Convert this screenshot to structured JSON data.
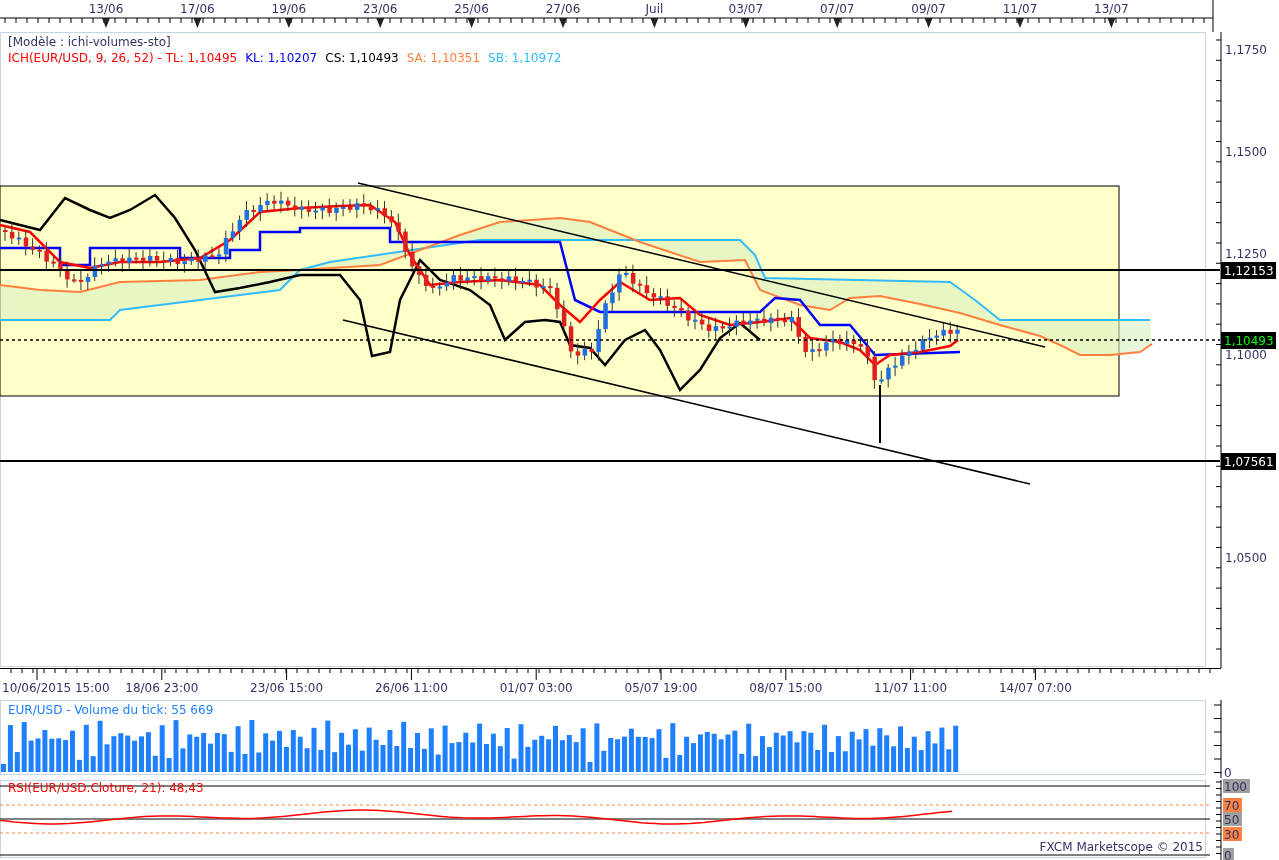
{
  "top_axis": {
    "labels": [
      "13/06",
      "17/06",
      "19/06",
      "23/06",
      "25/06",
      "27/06",
      "Juil",
      "03/07",
      "07/07",
      "09/07",
      "11/07",
      "13/07"
    ]
  },
  "legend": {
    "template": "[Modèle : ichi-volumes-sto]",
    "values": [
      {
        "text": "ICH(EUR/USD, 9, 26, 52) -  TL: 1,10495",
        "color": "#ff0000"
      },
      {
        "text": "KL: 1,10207",
        "color": "#0000ff"
      },
      {
        "text": "CS: 1,10493",
        "color": "#000000"
      },
      {
        "text": "SA: 1,10351",
        "color": "#ff7f3f"
      },
      {
        "text": "SB: 1,10972",
        "color": "#33bbff"
      }
    ]
  },
  "price_axis": {
    "labels": [
      "1,1750",
      "1,1500",
      "1,1250",
      "1,1000",
      "1,0500"
    ],
    "markers": [
      {
        "text": "1,12153",
        "color": "#ffffff"
      },
      {
        "text": "1,10493",
        "color": "#00ff00"
      },
      {
        "text": "1,07561",
        "color": "#ffffff"
      }
    ]
  },
  "time_axis": {
    "labels": [
      "10/06/2015 15:00",
      "18/06 23:00",
      "23/06 15:00",
      "26/06 11:00",
      "01/07 03:00",
      "05/07 19:00",
      "08/07 15:00",
      "11/07 11:00",
      "14/07 07:00"
    ]
  },
  "volume": {
    "title": "EUR/USD - Volume du tick: 55 669",
    "axis_label": "0"
  },
  "rsi": {
    "title": "RSI(EUR/USD.Cloture, 21): 48,43",
    "levels": [
      {
        "text": "100",
        "color": "#a0a0a0"
      },
      {
        "text": "70",
        "color": "#ff8040"
      },
      {
        "text": "50",
        "color": "#a0a0a0"
      },
      {
        "text": "30",
        "color": "#ff8040"
      },
      {
        "text": "0",
        "color": "#a0a0a0"
      }
    ]
  },
  "footer": "FXCM Marketscope © 2015"
}
